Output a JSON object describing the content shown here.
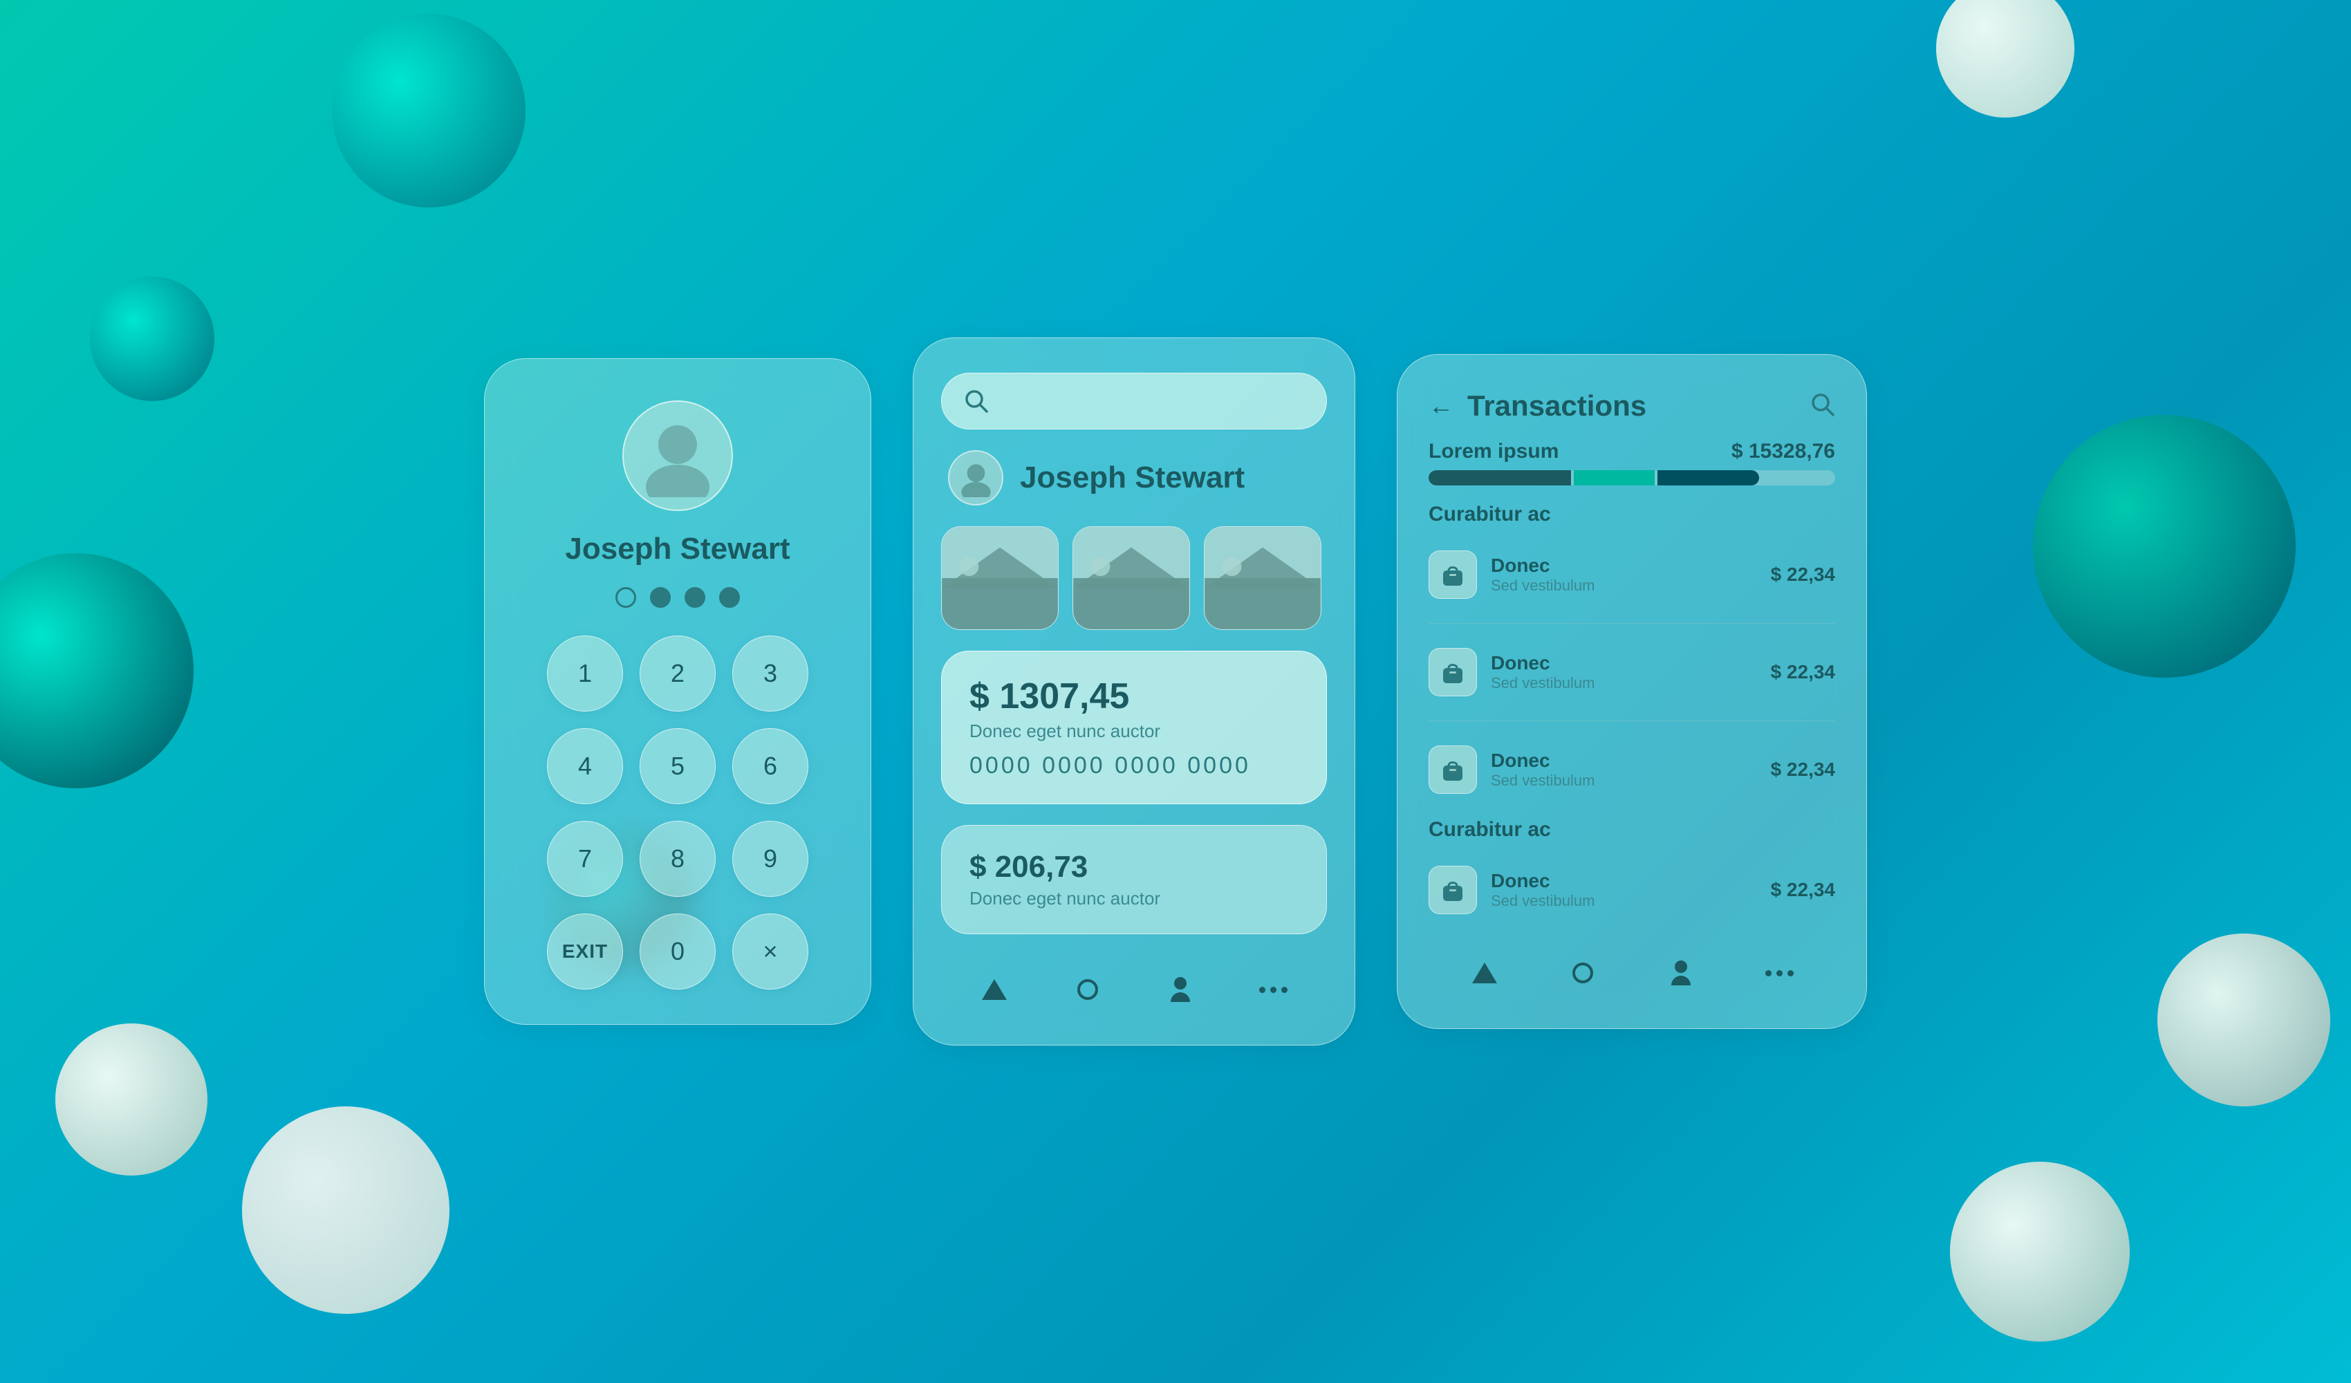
{
  "background": {
    "gradient_start": "#00c9b0",
    "gradient_end": "#0096b8"
  },
  "pin_panel": {
    "user_name": "Joseph Stewart",
    "dots": [
      {
        "state": "empty"
      },
      {
        "state": "filled"
      },
      {
        "state": "filled"
      },
      {
        "state": "filled"
      }
    ],
    "keys": [
      "1",
      "2",
      "3",
      "4",
      "5",
      "6",
      "7",
      "8",
      "9",
      "EXIT",
      "0",
      "×"
    ]
  },
  "app_panel": {
    "search_placeholder": "",
    "user_name": "Joseph Stewart",
    "balance_1": {
      "amount": "$ 1307,45",
      "description": "Donec eget nunc auctor",
      "card_number": "0000 0000 0000 0000"
    },
    "balance_2": {
      "amount": "$ 206,73",
      "description": "Donec eget nunc auctor"
    },
    "nav": {
      "items": [
        "home",
        "circle",
        "person",
        "more"
      ]
    }
  },
  "transactions_panel": {
    "title": "Transactions",
    "section_1": {
      "label": "Lorem ipsum",
      "amount": "$ 15328,76"
    },
    "section_2_label": "Curabitur ac",
    "items_1": [
      {
        "name": "Donec",
        "sub": "Sed vestibulum",
        "amount": "$ 22,34"
      },
      {
        "name": "Donec",
        "sub": "Sed vestibulum",
        "amount": "$ 22,34"
      },
      {
        "name": "Donec",
        "sub": "Sed vestibulum",
        "amount": "$ 22,34"
      }
    ],
    "section_3_label": "Curabitur ac",
    "items_2": [
      {
        "name": "Donec",
        "sub": "Sed vestibulum",
        "amount": "$ 22,34"
      }
    ],
    "nav": {
      "items": [
        "home",
        "circle",
        "person",
        "more"
      ]
    }
  }
}
